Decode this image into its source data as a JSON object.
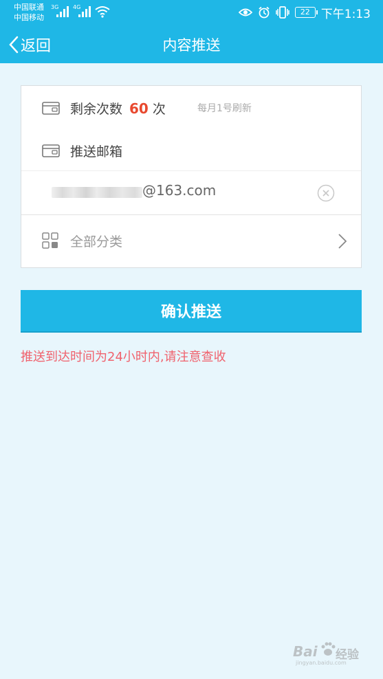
{
  "status_bar": {
    "carrier1": "中国联通",
    "carrier2": "中国移动",
    "network1": "3G",
    "network2": "4G",
    "battery": "22",
    "time": "下午1:13",
    "icons": [
      "eye-icon",
      "alarm-icon",
      "vibrate-icon",
      "battery-icon",
      "wifi-icon",
      "signal-icon"
    ]
  },
  "nav": {
    "back_label": "返回",
    "title": "内容推送"
  },
  "card": {
    "remaining_label": "剩余次数",
    "remaining_count": "60",
    "remaining_unit": "次",
    "refresh_note": "每月1号刷新",
    "email_label": "推送邮箱",
    "email_value": "@163.com",
    "category_label": "全部分类"
  },
  "confirm_button": "确认推送",
  "hint": "推送到达时间为24小时内,请注意查收",
  "watermark": {
    "brand": "Bai",
    "cn": "经验",
    "url": "jingyan.baidu.com"
  },
  "colors": {
    "primary": "#1fb7e6",
    "background": "#e8f6fc",
    "count": "#e8492f",
    "hint": "#f0626d"
  }
}
